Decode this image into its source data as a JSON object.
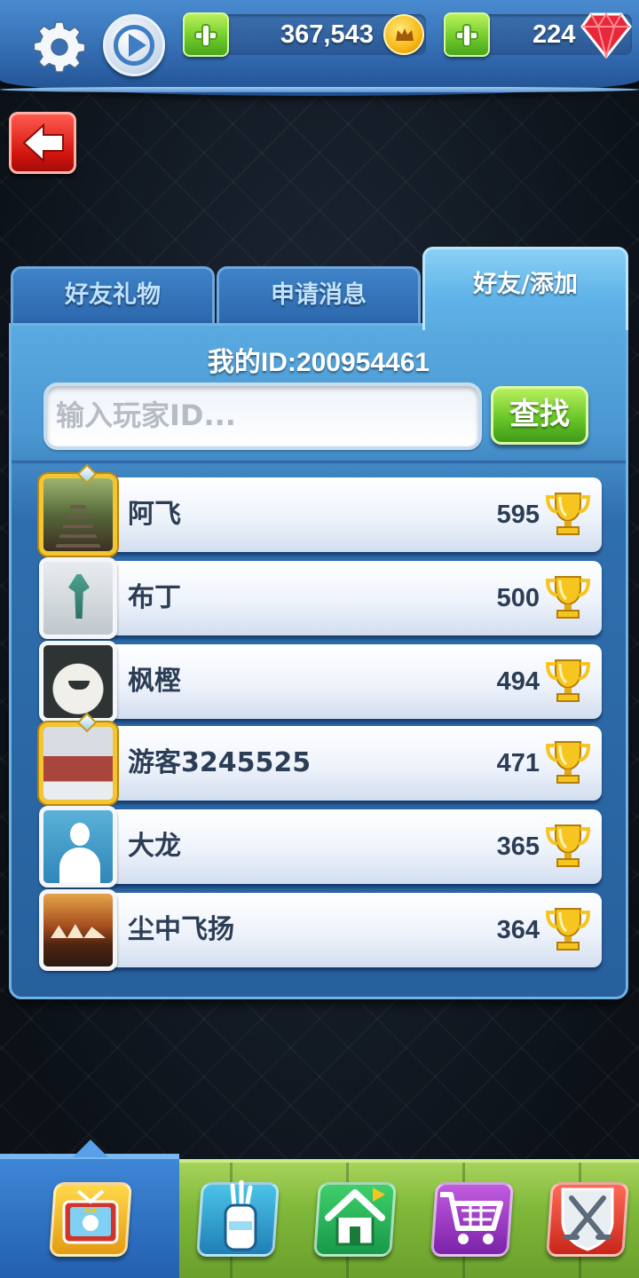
{
  "topbar": {
    "coins": "367,543",
    "gems": "224",
    "icons": [
      "gear-icon",
      "play-icon",
      "plus-icon",
      "crown-coin-icon",
      "ruby-gem-icon"
    ]
  },
  "tabs": [
    {
      "label": "好友礼物",
      "active": false
    },
    {
      "label": "申请消息",
      "active": false
    },
    {
      "label": "好友/添加",
      "active": true
    }
  ],
  "panel": {
    "my_id": "我的ID:200954461",
    "search_placeholder": "输入玩家ID...",
    "find_button": "查找"
  },
  "friends": [
    {
      "name": "阿飞",
      "score": "595",
      "frame": "gold",
      "avatar": "railway-photo"
    },
    {
      "name": "布丁",
      "score": "500",
      "frame": "silver",
      "avatar": "robot-figure-photo"
    },
    {
      "name": "枫樫",
      "score": "494",
      "frame": "silver",
      "avatar": "bunny-figure-photo"
    },
    {
      "name": "游客3245525",
      "score": "471",
      "frame": "gold",
      "avatar": "building-photo"
    },
    {
      "name": "大龙",
      "score": "365",
      "frame": "silver",
      "avatar": "default-avatar"
    },
    {
      "name": "尘中飞扬",
      "score": "364",
      "frame": "silver",
      "avatar": "opera-house-photo"
    }
  ],
  "bottom_nav": [
    {
      "icon": "tv-icon",
      "selected": true
    },
    {
      "icon": "golf-bag-icon",
      "selected": false
    },
    {
      "icon": "home-icon",
      "selected": false
    },
    {
      "icon": "shop-cart-icon",
      "selected": false
    },
    {
      "icon": "crossed-clubs-icon",
      "selected": false
    }
  ],
  "colors": {
    "accent_blue": "#4b97d2",
    "button_green": "#6ac72a",
    "back_red": "#d3140f",
    "gold_frame": "#f2c531"
  }
}
